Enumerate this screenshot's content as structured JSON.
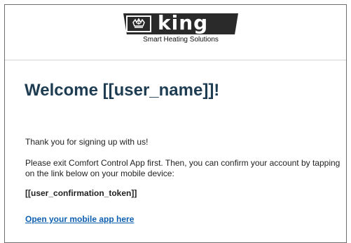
{
  "header": {
    "logo_text": "king",
    "tagline": "Smart Heating Solutions",
    "icon": "crown-icon"
  },
  "main": {
    "welcome_title": "Welcome [[user_name]]!",
    "thanks_text": "Thank you for signing up with us!",
    "instruction_text": "Please exit Comfort Control App first. Then, you can confirm your account by tapping on the link below on your mobile device:",
    "token_text": "[[user_confirmation_token]]",
    "link_text": "Open your mobile app here"
  },
  "colors": {
    "logo_bg": "#2a2a2a",
    "title": "#1e3d53",
    "link": "#0f5fb0"
  }
}
